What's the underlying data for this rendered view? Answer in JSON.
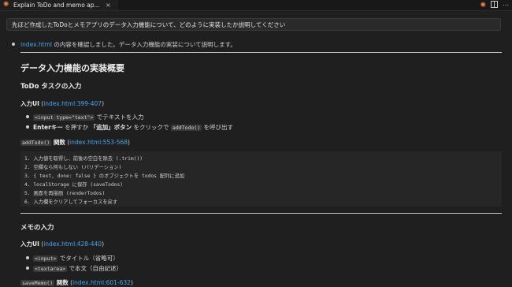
{
  "window": {
    "tab_title": "Explain ToDo and memo ap...",
    "logo_icon": "claude-spark-icon",
    "close_glyph": "×"
  },
  "prompt": {
    "text": "先ほど作成したToDoとメモアプリのデータ入力機能について、どのように実装したか説明してください"
  },
  "status": {
    "file_link": "index.html",
    "text": " の内容を確認しました。データ入力機能の実装について説明します。"
  },
  "heading": "データ入力機能の実装概要",
  "todo": {
    "heading": "ToDo タスクの入力",
    "ui_label": "入力UI",
    "ui_link": "index.html:399-407",
    "ui_items": [
      {
        "code": "<input type=\"text\">",
        "text": " でテキストを入力"
      },
      {
        "bold1": "Enterキー",
        "mid": " を押すか ",
        "bold2": "「追加」ボタン",
        "mid2": " をクリックで ",
        "code": "addTodo()",
        "text": " を呼び出す"
      }
    ],
    "func_code": "addTodo()",
    "func_label": " 関数",
    "func_link": "index.html:553-568",
    "steps": [
      "1. 入力値を取得し、前後の空白を除去 (.trim())",
      "2. 空欄なら何もしない (バリデーション)",
      "3. { text, done: false } のオブジェクトを todos 配列に追加",
      "4. localStorage に保存 (saveTodos)",
      "5. 画面を再描画 (renderTodos)",
      "6. 入力欄をクリアしてフォーカスを戻す"
    ]
  },
  "memo": {
    "heading": "メモの入力",
    "ui_label": "入力UI",
    "ui_link": "index.html:428-440",
    "ui_items": [
      {
        "code": "<input>",
        "text": " でタイトル（省略可）"
      },
      {
        "code": "<textarea>",
        "text": " で本文（自由記述）"
      }
    ],
    "func_code": "saveMemo()",
    "func_label": " 関数",
    "func_link": "index.html:601-632"
  }
}
